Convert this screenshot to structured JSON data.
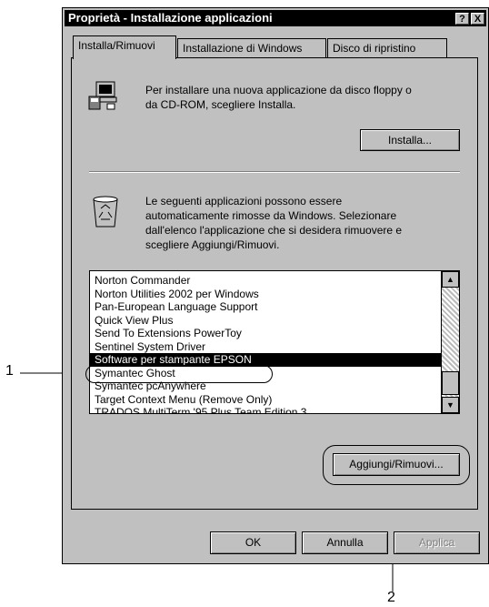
{
  "window": {
    "title": "Proprietà - Installazione applicazioni"
  },
  "title_buttons": {
    "help": "?",
    "close": "X"
  },
  "tabs": [
    {
      "label": "Installa/Rimuovi"
    },
    {
      "label": "Installazione di Windows"
    },
    {
      "label": "Disco di ripristino"
    }
  ],
  "install": {
    "line1": "Per installare una nuova applicazione da disco floppy o",
    "line2": "da CD-ROM, scegliere Installa.",
    "button_label": "Installa...",
    "icon": "install-computer-icon"
  },
  "remove": {
    "line1": "Le seguenti applicazioni possono essere",
    "line2": "automaticamente rimosse da Windows. Selezionare",
    "line3": "dall'elenco l'applicazione che si desidera rimuovere e",
    "line4": "scegliere Aggiungi/Rimuovi.",
    "icon": "recycle-bin-icon"
  },
  "app_list": [
    "Norton Commander",
    "Norton Utilities 2002 per Windows",
    "Pan-European Language Support",
    "Quick View Plus",
    "Send To Extensions PowerToy",
    "Sentinel System Driver",
    "Software per stampante EPSON",
    "Symantec Ghost",
    "Symantec pcAnywhere",
    "Target Context Menu (Remove Only)",
    "TRADOS MultiTerm '95 Plus Team Edition 3"
  ],
  "selected_app": "Software per stampante EPSON",
  "add_remove_button": "Aggiungi/Rimuovi...",
  "footer": {
    "ok": "OK",
    "cancel": "Annulla",
    "apply": "Applica"
  },
  "callouts": {
    "one": "1",
    "two": "2"
  }
}
